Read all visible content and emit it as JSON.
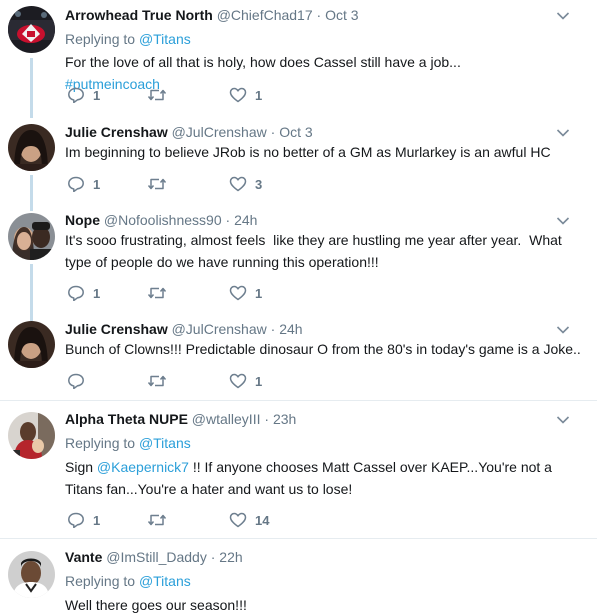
{
  "tweets": [
    {
      "name": "Arrowhead True North",
      "handle": "@ChiefChad17",
      "time": "Oct 3",
      "replying_label": "Replying to",
      "replying_to": "@Titans",
      "text_parts": [
        "For the love of all that is holy, how does Cassel still have a job... ",
        "#putmeincoach"
      ],
      "replies": "1",
      "retweets": "",
      "likes": "1"
    },
    {
      "name": "Julie Crenshaw",
      "handle": "@JulCrenshaw",
      "time": "Oct 3",
      "text": "Im beginning to believe JRob is no better of a GM as Murlarkey is an awful HC",
      "replies": "1",
      "retweets": "",
      "likes": "3"
    },
    {
      "name": "Nope",
      "handle": "@Nofoolishness90",
      "time": "24h",
      "text_lines": [
        "It's sooo frustrating, almost feels  like they are hustling me year after year.  What",
        "type of people do we have running this operation!!!"
      ],
      "replies": "1",
      "retweets": "",
      "likes": "1"
    },
    {
      "name": "Julie Crenshaw",
      "handle": "@JulCrenshaw",
      "time": "24h",
      "text": "Bunch of Clowns!!! Predictable dinosaur O from the 80's in today's game is a Joke..",
      "replies": "",
      "retweets": "",
      "likes": "1"
    },
    {
      "name": "Alpha Theta NUPE",
      "handle": "@wtalleyIII",
      "time": "23h",
      "replying_label": "Replying to",
      "replying_to": "@Titans",
      "text_l1_a": "Sign ",
      "text_l1_link": "@Kaepernick7",
      "text_l1_b": " !! If anyone chooses Matt Cassel over KAEP...You're not a",
      "text_l2": "Titans fan...You're a hater and want us to lose!",
      "replies": "1",
      "retweets": "",
      "likes": "14"
    },
    {
      "name": "Vante",
      "handle": "@ImStill_Daddy",
      "time": "22h",
      "replying_label": "Replying to",
      "replying_to": "@Titans",
      "text": "Well there goes our season!!!"
    }
  ],
  "separator": "·",
  "colors": {
    "link": "#2b9fd9",
    "secondary": "#657786",
    "thread_line": "#c4dbea",
    "divider": "#e6ecf0"
  },
  "icons": {
    "reply": "reply-icon",
    "retweet": "retweet-icon",
    "like": "heart-icon",
    "menu": "chevron-down-icon"
  }
}
